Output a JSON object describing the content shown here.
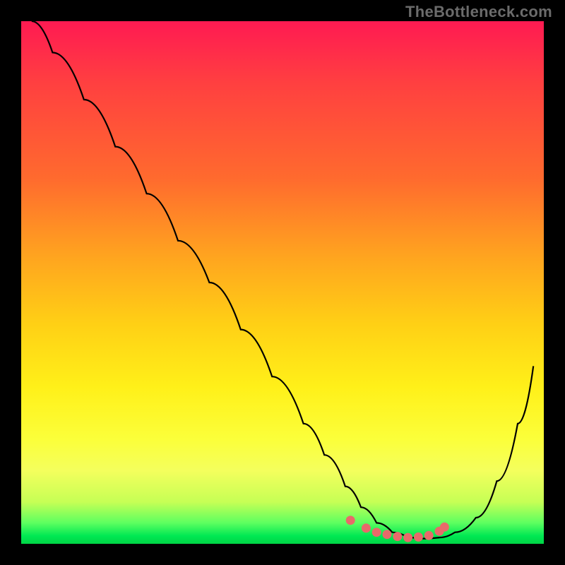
{
  "watermark": "TheBottleneck.com",
  "colors": {
    "frame_bg": "#000000",
    "curve_stroke": "#000000",
    "dot_fill": "#e86a6a",
    "gradient_stops": [
      "#ff1a52",
      "#ff4040",
      "#ff6a2e",
      "#ffa41f",
      "#ffd015",
      "#fff019",
      "#fbff3a",
      "#f4ff5d",
      "#c6ff55",
      "#5dff60",
      "#00e853",
      "#00d545"
    ]
  },
  "chart_data": {
    "type": "line",
    "title": "",
    "xlabel": "",
    "ylabel": "",
    "xlim": [
      0,
      100
    ],
    "ylim": [
      0,
      100
    ],
    "grid": false,
    "legend": false,
    "annotations": [],
    "series": [
      {
        "name": "bottleneck-curve",
        "x": [
          2,
          6,
          12,
          18,
          24,
          30,
          36,
          42,
          48,
          54,
          58,
          62,
          65,
          68,
          71,
          74,
          77,
          80,
          83,
          87,
          91,
          95,
          98
        ],
        "values": [
          100,
          94,
          85,
          76,
          67,
          58,
          50,
          41,
          32,
          23,
          17,
          11,
          7,
          4,
          2.2,
          1.2,
          1.0,
          1.2,
          2.2,
          5,
          12,
          23,
          34
        ]
      }
    ],
    "optimal_points": {
      "name": "optimal-range-dots",
      "x": [
        63,
        66,
        68,
        70,
        72,
        74,
        76,
        78,
        80,
        81
      ],
      "values": [
        4.5,
        3.0,
        2.2,
        1.8,
        1.4,
        1.2,
        1.3,
        1.6,
        2.4,
        3.2
      ]
    }
  }
}
